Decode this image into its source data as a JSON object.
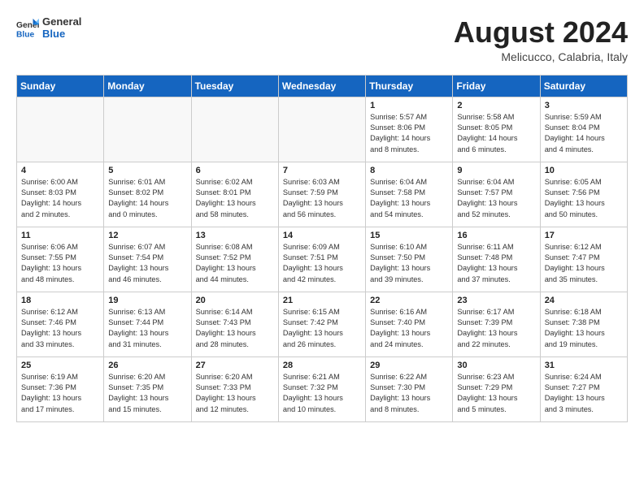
{
  "header": {
    "logo_general": "General",
    "logo_blue": "Blue",
    "month_title": "August 2024",
    "location": "Melicucco, Calabria, Italy"
  },
  "weekdays": [
    "Sunday",
    "Monday",
    "Tuesday",
    "Wednesday",
    "Thursday",
    "Friday",
    "Saturday"
  ],
  "weeks": [
    [
      {
        "day": "",
        "info": "",
        "empty": true
      },
      {
        "day": "",
        "info": "",
        "empty": true
      },
      {
        "day": "",
        "info": "",
        "empty": true
      },
      {
        "day": "",
        "info": "",
        "empty": true
      },
      {
        "day": "1",
        "info": "Sunrise: 5:57 AM\nSunset: 8:06 PM\nDaylight: 14 hours\nand 8 minutes."
      },
      {
        "day": "2",
        "info": "Sunrise: 5:58 AM\nSunset: 8:05 PM\nDaylight: 14 hours\nand 6 minutes."
      },
      {
        "day": "3",
        "info": "Sunrise: 5:59 AM\nSunset: 8:04 PM\nDaylight: 14 hours\nand 4 minutes."
      }
    ],
    [
      {
        "day": "4",
        "info": "Sunrise: 6:00 AM\nSunset: 8:03 PM\nDaylight: 14 hours\nand 2 minutes."
      },
      {
        "day": "5",
        "info": "Sunrise: 6:01 AM\nSunset: 8:02 PM\nDaylight: 14 hours\nand 0 minutes."
      },
      {
        "day": "6",
        "info": "Sunrise: 6:02 AM\nSunset: 8:01 PM\nDaylight: 13 hours\nand 58 minutes."
      },
      {
        "day": "7",
        "info": "Sunrise: 6:03 AM\nSunset: 7:59 PM\nDaylight: 13 hours\nand 56 minutes."
      },
      {
        "day": "8",
        "info": "Sunrise: 6:04 AM\nSunset: 7:58 PM\nDaylight: 13 hours\nand 54 minutes."
      },
      {
        "day": "9",
        "info": "Sunrise: 6:04 AM\nSunset: 7:57 PM\nDaylight: 13 hours\nand 52 minutes."
      },
      {
        "day": "10",
        "info": "Sunrise: 6:05 AM\nSunset: 7:56 PM\nDaylight: 13 hours\nand 50 minutes."
      }
    ],
    [
      {
        "day": "11",
        "info": "Sunrise: 6:06 AM\nSunset: 7:55 PM\nDaylight: 13 hours\nand 48 minutes."
      },
      {
        "day": "12",
        "info": "Sunrise: 6:07 AM\nSunset: 7:54 PM\nDaylight: 13 hours\nand 46 minutes."
      },
      {
        "day": "13",
        "info": "Sunrise: 6:08 AM\nSunset: 7:52 PM\nDaylight: 13 hours\nand 44 minutes."
      },
      {
        "day": "14",
        "info": "Sunrise: 6:09 AM\nSunset: 7:51 PM\nDaylight: 13 hours\nand 42 minutes."
      },
      {
        "day": "15",
        "info": "Sunrise: 6:10 AM\nSunset: 7:50 PM\nDaylight: 13 hours\nand 39 minutes."
      },
      {
        "day": "16",
        "info": "Sunrise: 6:11 AM\nSunset: 7:48 PM\nDaylight: 13 hours\nand 37 minutes."
      },
      {
        "day": "17",
        "info": "Sunrise: 6:12 AM\nSunset: 7:47 PM\nDaylight: 13 hours\nand 35 minutes."
      }
    ],
    [
      {
        "day": "18",
        "info": "Sunrise: 6:12 AM\nSunset: 7:46 PM\nDaylight: 13 hours\nand 33 minutes."
      },
      {
        "day": "19",
        "info": "Sunrise: 6:13 AM\nSunset: 7:44 PM\nDaylight: 13 hours\nand 31 minutes."
      },
      {
        "day": "20",
        "info": "Sunrise: 6:14 AM\nSunset: 7:43 PM\nDaylight: 13 hours\nand 28 minutes."
      },
      {
        "day": "21",
        "info": "Sunrise: 6:15 AM\nSunset: 7:42 PM\nDaylight: 13 hours\nand 26 minutes."
      },
      {
        "day": "22",
        "info": "Sunrise: 6:16 AM\nSunset: 7:40 PM\nDaylight: 13 hours\nand 24 minutes."
      },
      {
        "day": "23",
        "info": "Sunrise: 6:17 AM\nSunset: 7:39 PM\nDaylight: 13 hours\nand 22 minutes."
      },
      {
        "day": "24",
        "info": "Sunrise: 6:18 AM\nSunset: 7:38 PM\nDaylight: 13 hours\nand 19 minutes."
      }
    ],
    [
      {
        "day": "25",
        "info": "Sunrise: 6:19 AM\nSunset: 7:36 PM\nDaylight: 13 hours\nand 17 minutes."
      },
      {
        "day": "26",
        "info": "Sunrise: 6:20 AM\nSunset: 7:35 PM\nDaylight: 13 hours\nand 15 minutes."
      },
      {
        "day": "27",
        "info": "Sunrise: 6:20 AM\nSunset: 7:33 PM\nDaylight: 13 hours\nand 12 minutes."
      },
      {
        "day": "28",
        "info": "Sunrise: 6:21 AM\nSunset: 7:32 PM\nDaylight: 13 hours\nand 10 minutes."
      },
      {
        "day": "29",
        "info": "Sunrise: 6:22 AM\nSunset: 7:30 PM\nDaylight: 13 hours\nand 8 minutes."
      },
      {
        "day": "30",
        "info": "Sunrise: 6:23 AM\nSunset: 7:29 PM\nDaylight: 13 hours\nand 5 minutes."
      },
      {
        "day": "31",
        "info": "Sunrise: 6:24 AM\nSunset: 7:27 PM\nDaylight: 13 hours\nand 3 minutes."
      }
    ]
  ]
}
